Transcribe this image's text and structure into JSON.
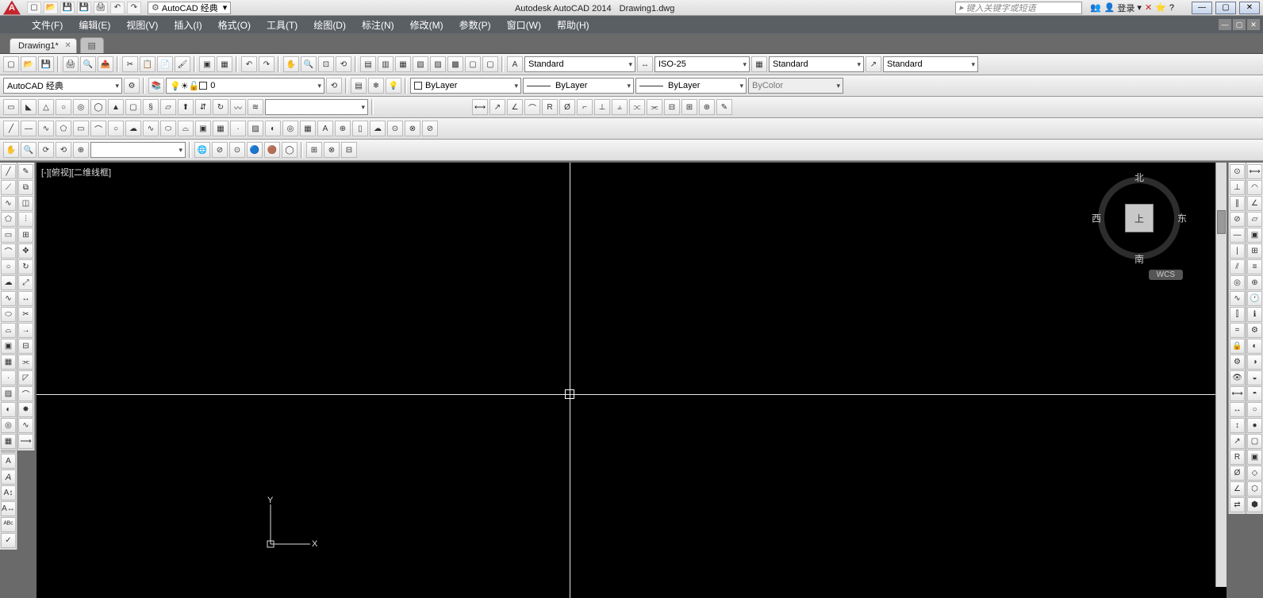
{
  "title": {
    "app": "Autodesk AutoCAD 2014",
    "file": "Drawing1.dwg",
    "workspace": "AutoCAD 经典",
    "search_placeholder": "键入关键字或短语",
    "login": "登录"
  },
  "menus": {
    "file": "文件(F)",
    "edit": "编辑(E)",
    "view": "视图(V)",
    "insert": "插入(I)",
    "format": "格式(O)",
    "tools": "工具(T)",
    "draw": "绘图(D)",
    "dimension": "标注(N)",
    "modify": "修改(M)",
    "parametric": "参数(P)",
    "window": "窗口(W)",
    "help": "帮助(H)"
  },
  "doctab": {
    "name": "Drawing1*"
  },
  "styles": {
    "textstyle": "Standard",
    "dimstyle": "ISO-25",
    "tablestyle": "Standard",
    "mleader": "Standard",
    "workspace2": "AutoCAD 经典",
    "layer": "0",
    "layer_color": "ByLayer",
    "linetype": "ByLayer",
    "lineweight": "ByLayer",
    "plotstyle": "ByColor"
  },
  "viewport": {
    "label": "[-][俯视][二维线框]",
    "ucs_x": "X",
    "ucs_y": "Y",
    "wcs": "WCS"
  },
  "viewcube": {
    "top": "上",
    "north": "北",
    "south": "南",
    "east": "东",
    "west": "西"
  }
}
